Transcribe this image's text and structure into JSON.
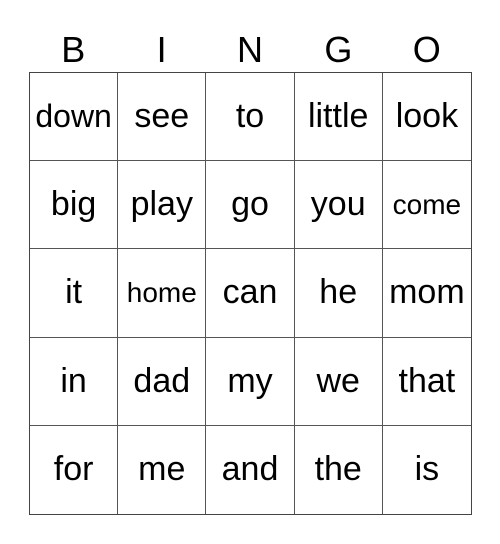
{
  "header": [
    "B",
    "I",
    "N",
    "G",
    "O"
  ],
  "cells": [
    [
      "down",
      "see",
      "to",
      "little",
      "look"
    ],
    [
      "big",
      "play",
      "go",
      "you",
      "come"
    ],
    [
      "it",
      "home",
      "can",
      "he",
      "mom"
    ],
    [
      "in",
      "dad",
      "my",
      "we",
      "that"
    ],
    [
      "for",
      "me",
      "and",
      "the",
      "is"
    ]
  ]
}
